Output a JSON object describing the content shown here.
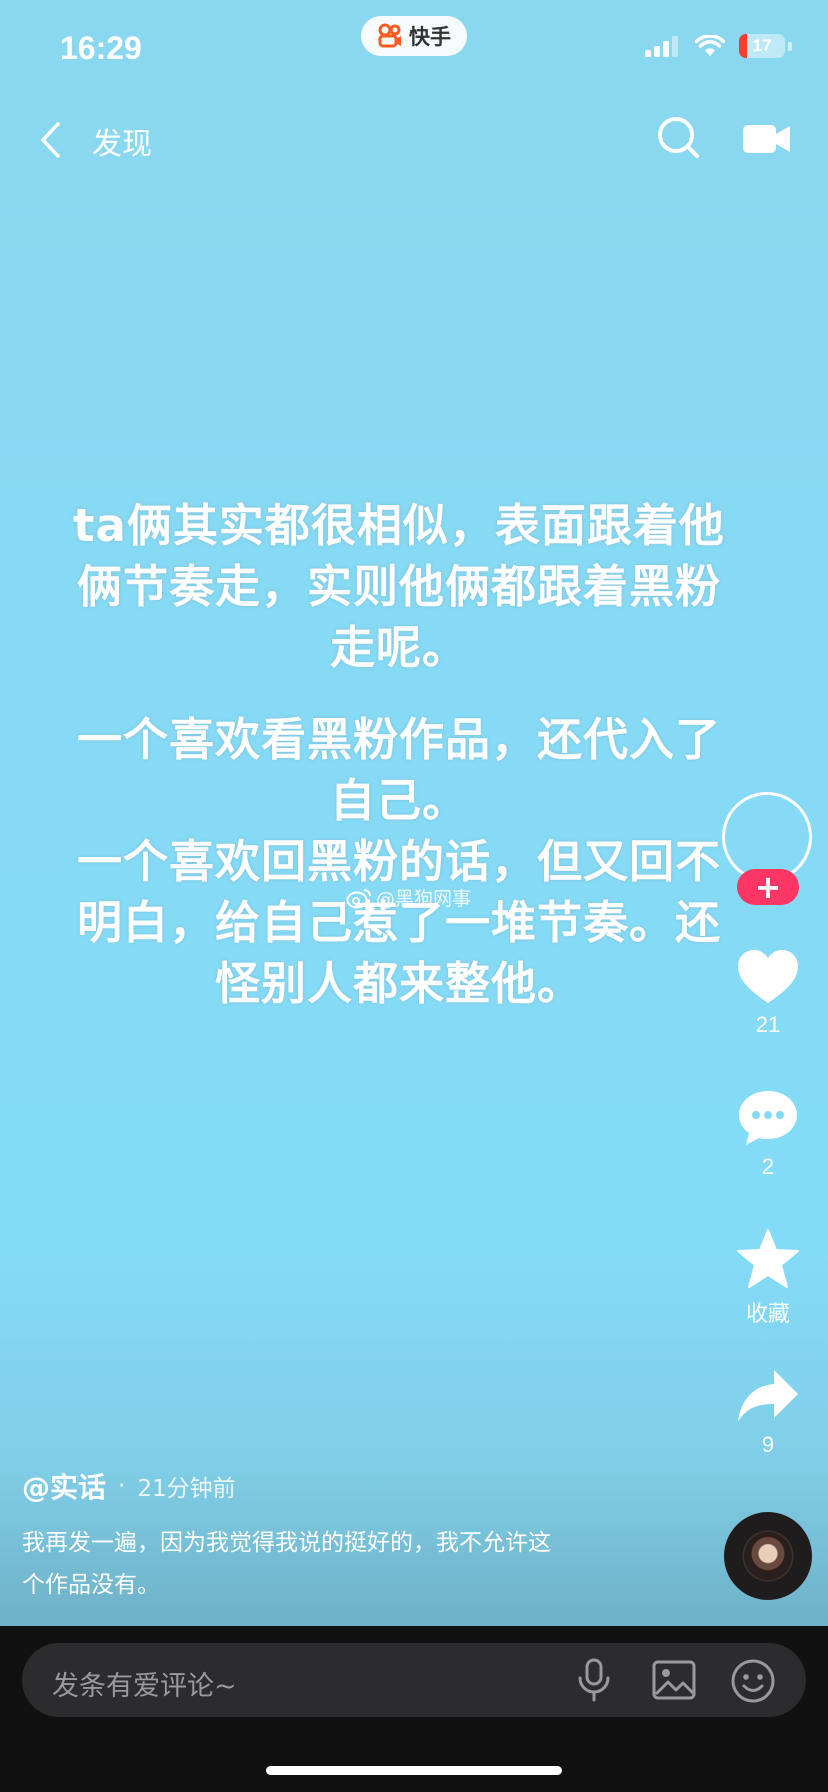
{
  "status_bar": {
    "time": "16:29",
    "battery": "17",
    "battery_level": 0.17,
    "app_name": "快手"
  },
  "nav": {
    "back_label": "发现"
  },
  "post": {
    "paragraph1": "ta俩其实都很相似，表面跟着他\n俩节奏走，实则他俩都跟着黑粉\n走呢。",
    "paragraph2": "一个喜欢看黑粉作品，还代入了\n自己。\n一个喜欢回黑粉的话，但又回不\n明白，给自己惹了一堆节奏。还\n怪别人都来整他。",
    "watermark": "@黑狗网事"
  },
  "actions": {
    "follow_symbol": "+",
    "likes": "21",
    "comments": "2",
    "collect_label": "收藏",
    "shares": "9"
  },
  "author": {
    "name": "@实话",
    "separator": "·",
    "time": "21分钟前"
  },
  "caption": "我再发一遍，因为我觉得我说的挺好的，我不允许这\n个作品没有。",
  "comment_bar": {
    "placeholder": "发条有爱评论~"
  },
  "colors": {
    "follow_red": "#fe3666",
    "bg_top": "#8ad8ef",
    "bar_bg": "#111111",
    "input_bg": "#2c2c2e"
  }
}
